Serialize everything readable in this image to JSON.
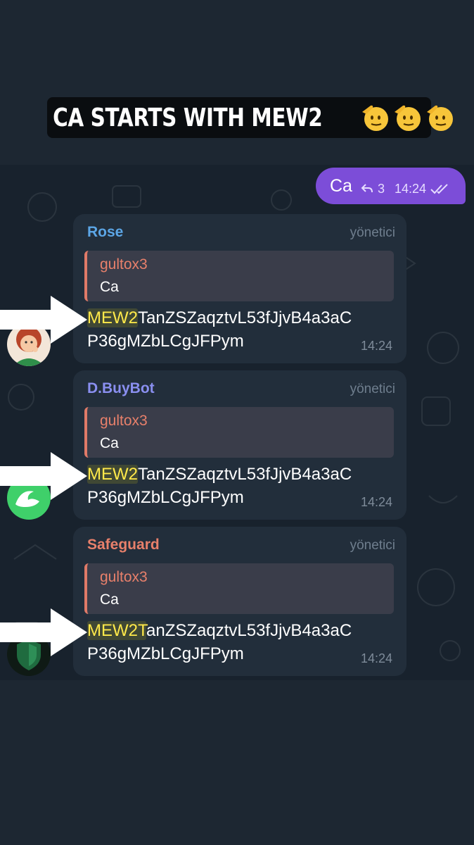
{
  "caption": {
    "text": "CA STARTS WITH MEW2",
    "emoji": "saluting-face",
    "emoji_count": 3
  },
  "colors": {
    "out_bubble": "#7c4dd8",
    "rose": "#5ca6e6",
    "dbuybot": "#8a8ff0",
    "safeguard": "#e8806b",
    "highlight": "#ffe94a"
  },
  "outgoing": {
    "text": "Ca",
    "replies": "3",
    "time": "14:24",
    "status": "double-check-icon"
  },
  "messages": [
    {
      "sender": "Rose",
      "role": "yönetici",
      "reply_to": {
        "name": "gultox3",
        "text": "Ca"
      },
      "highlight": "MEW2",
      "line1_rest": "TanZSZaqztvL53fJjvB4a3aC",
      "line2": "P36gMZbLCgJFPym",
      "time": "14:24"
    },
    {
      "sender": "D.BuyBot",
      "role": "yönetici",
      "reply_to": {
        "name": "gultox3",
        "text": "Ca"
      },
      "highlight": "MEW2",
      "line1_rest": "TanZSZaqztvL53fJjvB4a3aC",
      "line2": "P36gMZbLCgJFPym",
      "time": "14:24"
    },
    {
      "sender": "Safeguard",
      "role": "yönetici",
      "reply_to": {
        "name": "gultox3",
        "text": "Ca"
      },
      "highlight": "MEW2T",
      "line1_rest": "anZSZaqztvL53fJjvB4a3aC",
      "line2": "P36gMZbLCgJFPym",
      "time": "14:24"
    }
  ]
}
